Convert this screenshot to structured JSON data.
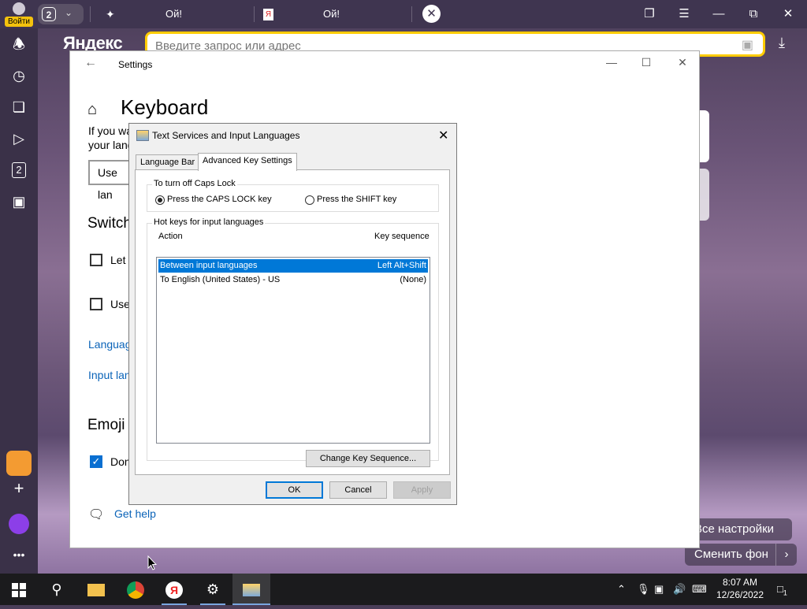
{
  "browser": {
    "login_label": "Войти",
    "tab_count": "2",
    "tabs": [
      {
        "title": "Ой!"
      },
      {
        "title": "Ой!"
      }
    ],
    "logo": "Яндекс",
    "address_placeholder": "Введите запрос или адрес",
    "sidebar_badge": "2",
    "overlay_buttons": {
      "all_settings": "Все настройки",
      "change_bg": "Сменить фон"
    }
  },
  "settings": {
    "window_title": "Settings",
    "page_title": "Keyboard",
    "desc_line1": "If you wa",
    "desc_line2": "your lang",
    "use_button": "Use lan",
    "switch_heading": "Switch",
    "let_label": "Let",
    "use_label": "Use",
    "language_link": "Languag",
    "input_link": "Input lan",
    "emoji_heading": "Emoji",
    "done_label": "Don",
    "get_help": "Get help"
  },
  "dialog": {
    "title": "Text Services and Input Languages",
    "tabs": [
      {
        "label": "Language Bar",
        "active": false
      },
      {
        "label": "Advanced Key Settings",
        "active": true
      }
    ],
    "caps_group": {
      "label": "To turn off Caps Lock",
      "options": [
        {
          "label": "Press the CAPS LOCK key",
          "selected": true
        },
        {
          "label": "Press the SHIFT key",
          "selected": false
        }
      ]
    },
    "hotkeys_group": {
      "label": "Hot keys for input languages",
      "col_action": "Action",
      "col_key": "Key sequence",
      "rows": [
        {
          "action": "Between input languages",
          "key": "Left Alt+Shift",
          "selected": true
        },
        {
          "action": "To English (United States) - US",
          "key": "(None)",
          "selected": false
        }
      ],
      "change_button": "Change Key Sequence..."
    },
    "buttons": {
      "ok": "OK",
      "cancel": "Cancel",
      "apply": "Apply"
    }
  },
  "taskbar": {
    "time": "8:07 AM",
    "date": "12/26/2022",
    "notification_count": "1"
  }
}
